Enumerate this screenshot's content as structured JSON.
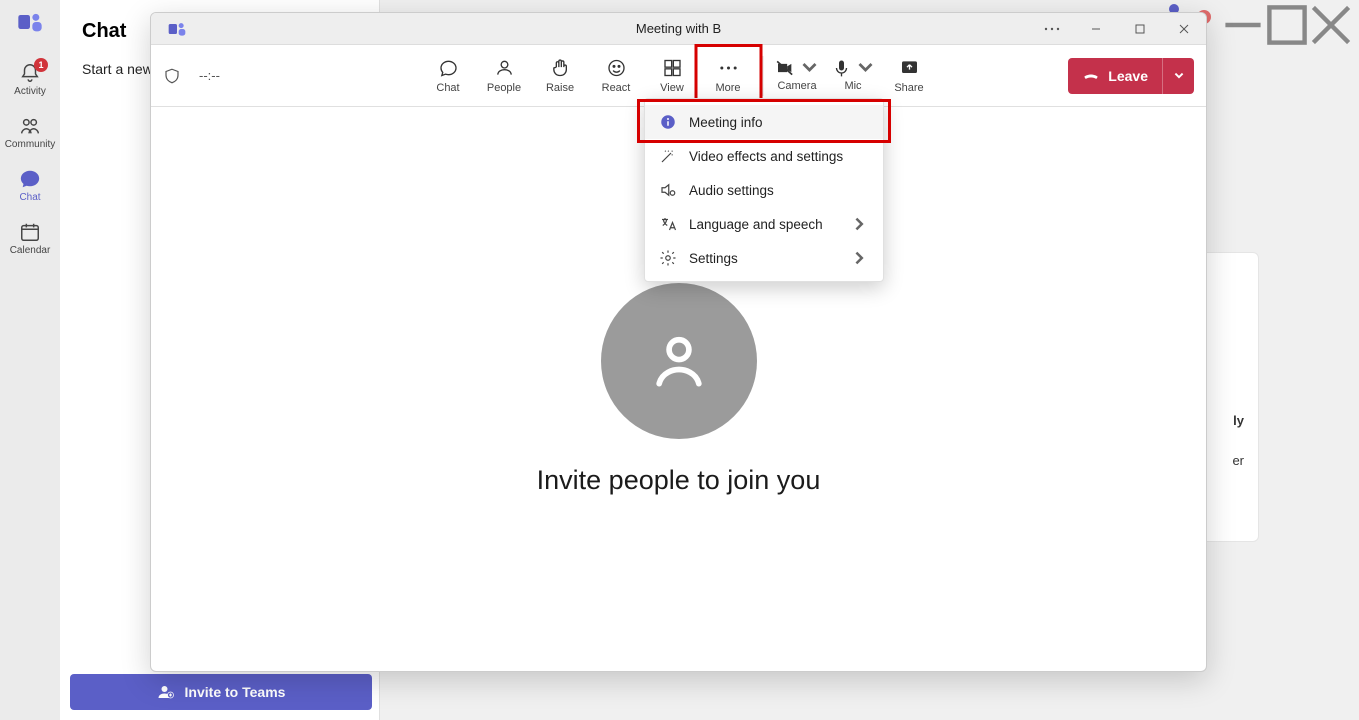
{
  "rail": {
    "activity": "Activity",
    "activity_badge": "1",
    "community": "Community",
    "chat": "Chat",
    "calendar": "Calendar"
  },
  "chat_panel": {
    "title": "Chat",
    "start_text": "Start a new"
  },
  "invite_teams_btn": "Invite to Teams",
  "peek": {
    "line1": "ly",
    "line2": "er"
  },
  "window": {
    "title": "Meeting with B",
    "timer": "--:--",
    "toolbar": {
      "chat": "Chat",
      "people": "People",
      "raise": "Raise",
      "react": "React",
      "view": "View",
      "more": "More",
      "camera": "Camera",
      "mic": "Mic",
      "share": "Share",
      "leave": "Leave"
    },
    "dropdown": {
      "meeting_info": "Meeting info",
      "video_effects": "Video effects and settings",
      "audio_settings": "Audio settings",
      "language": "Language and speech",
      "settings": "Settings"
    },
    "body_text": "Invite people to join you"
  }
}
